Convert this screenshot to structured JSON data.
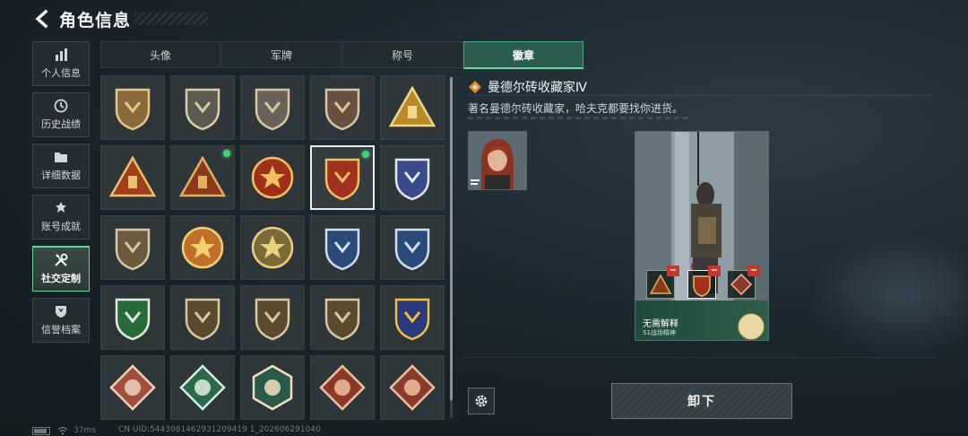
{
  "header": {
    "title": "角色信息"
  },
  "sidebar": {
    "items": [
      {
        "label": "个人信息",
        "icon": "bar-chart-icon",
        "active": false
      },
      {
        "label": "历史战绩",
        "icon": "clock-icon",
        "active": false
      },
      {
        "label": "详细数据",
        "icon": "folder-icon",
        "active": false
      },
      {
        "label": "账号成就",
        "icon": "medal-icon",
        "active": false
      },
      {
        "label": "社交定制",
        "icon": "tools-icon",
        "active": true
      },
      {
        "label": "信誉档案",
        "icon": "shield-icon",
        "active": false
      }
    ]
  },
  "tabs": [
    {
      "label": "头像",
      "active": false
    },
    {
      "label": "军牌",
      "active": false
    },
    {
      "label": "称号",
      "active": false
    },
    {
      "label": "徽章",
      "active": true
    }
  ],
  "badges": [
    {
      "shape": "shield",
      "color": "#8a6a3a",
      "accent": "#e0c98a",
      "dot": false,
      "selected": false
    },
    {
      "shape": "shield",
      "color": "#5c5a50",
      "accent": "#d8cfa8",
      "dot": false,
      "selected": false
    },
    {
      "shape": "shield",
      "color": "#6a6258",
      "accent": "#d6c8a0",
      "dot": false,
      "selected": false
    },
    {
      "shape": "shield",
      "color": "#6a5040",
      "accent": "#d6c8a0",
      "dot": false,
      "selected": false
    },
    {
      "shape": "triangle",
      "color": "#b98a2a",
      "accent": "#f0d890",
      "dot": false,
      "selected": false
    },
    {
      "shape": "triangle",
      "color": "#a0401a",
      "accent": "#e8c070",
      "dot": false,
      "selected": false
    },
    {
      "shape": "triangle",
      "color": "#8a3a1a",
      "accent": "#e0b060",
      "dot": true,
      "selected": false
    },
    {
      "shape": "round",
      "color": "#a0301a",
      "accent": "#f0c060",
      "dot": false,
      "selected": false
    },
    {
      "shape": "shield",
      "color": "#a03020",
      "accent": "#f0c060",
      "dot": true,
      "selected": true
    },
    {
      "shape": "shield",
      "color": "#3a4a8a",
      "accent": "#e0e8f0",
      "dot": false,
      "selected": false
    },
    {
      "shape": "shield",
      "color": "#6a5a40",
      "accent": "#d8c8a0",
      "dot": false,
      "selected": false
    },
    {
      "shape": "round",
      "color": "#c0702a",
      "accent": "#f0d070",
      "dot": false,
      "selected": false
    },
    {
      "shape": "round",
      "color": "#7a6a3a",
      "accent": "#e8d080",
      "dot": false,
      "selected": false
    },
    {
      "shape": "shield",
      "color": "#2a4a7a",
      "accent": "#d0e0f0",
      "dot": false,
      "selected": false
    },
    {
      "shape": "shield",
      "color": "#2a4a7a",
      "accent": "#d0e0f0",
      "dot": false,
      "selected": false
    },
    {
      "shape": "shield",
      "color": "#2a6a3a",
      "accent": "#e0f0e0",
      "dot": false,
      "selected": false
    },
    {
      "shape": "shield",
      "color": "#5a4a30",
      "accent": "#d8c8a0",
      "dot": false,
      "selected": false
    },
    {
      "shape": "shield",
      "color": "#5a4a30",
      "accent": "#d8c8a0",
      "dot": false,
      "selected": false
    },
    {
      "shape": "shield",
      "color": "#5a4a30",
      "accent": "#d8c8a0",
      "dot": false,
      "selected": false
    },
    {
      "shape": "shield",
      "color": "#2a3a7a",
      "accent": "#f0c040",
      "dot": false,
      "selected": false
    },
    {
      "shape": "diamond",
      "color": "#a0503a",
      "accent": "#f0d0c0",
      "dot": false,
      "selected": false
    },
    {
      "shape": "diamond",
      "color": "#2a6a4a",
      "accent": "#e0f0e0",
      "dot": false,
      "selected": false
    },
    {
      "shape": "hex",
      "color": "#2a5a4a",
      "accent": "#f0e0c0",
      "dot": false,
      "selected": false
    },
    {
      "shape": "diamond",
      "color": "#8a3a2a",
      "accent": "#f0c0a0",
      "dot": false,
      "selected": false
    },
    {
      "shape": "diamond",
      "color": "#8a3a2a",
      "accent": "#f0c0a0",
      "dot": false,
      "selected": false
    }
  ],
  "detail": {
    "title": "曼德尔砖收藏家Ⅳ",
    "description": "著名曼德尔砖收藏家，哈夫克都要找你进货。",
    "card_name": "无需解释",
    "card_subtitle": "S1战场精神",
    "unequip_label": "卸下"
  },
  "status": {
    "ping": "37ms",
    "uid": "CN UID:5443081462931209419 1_202606291040"
  },
  "colors": {
    "accent_green": "#62d49a",
    "tab_active_bg": "#2c5b51",
    "dot_green": "#44d37a"
  }
}
